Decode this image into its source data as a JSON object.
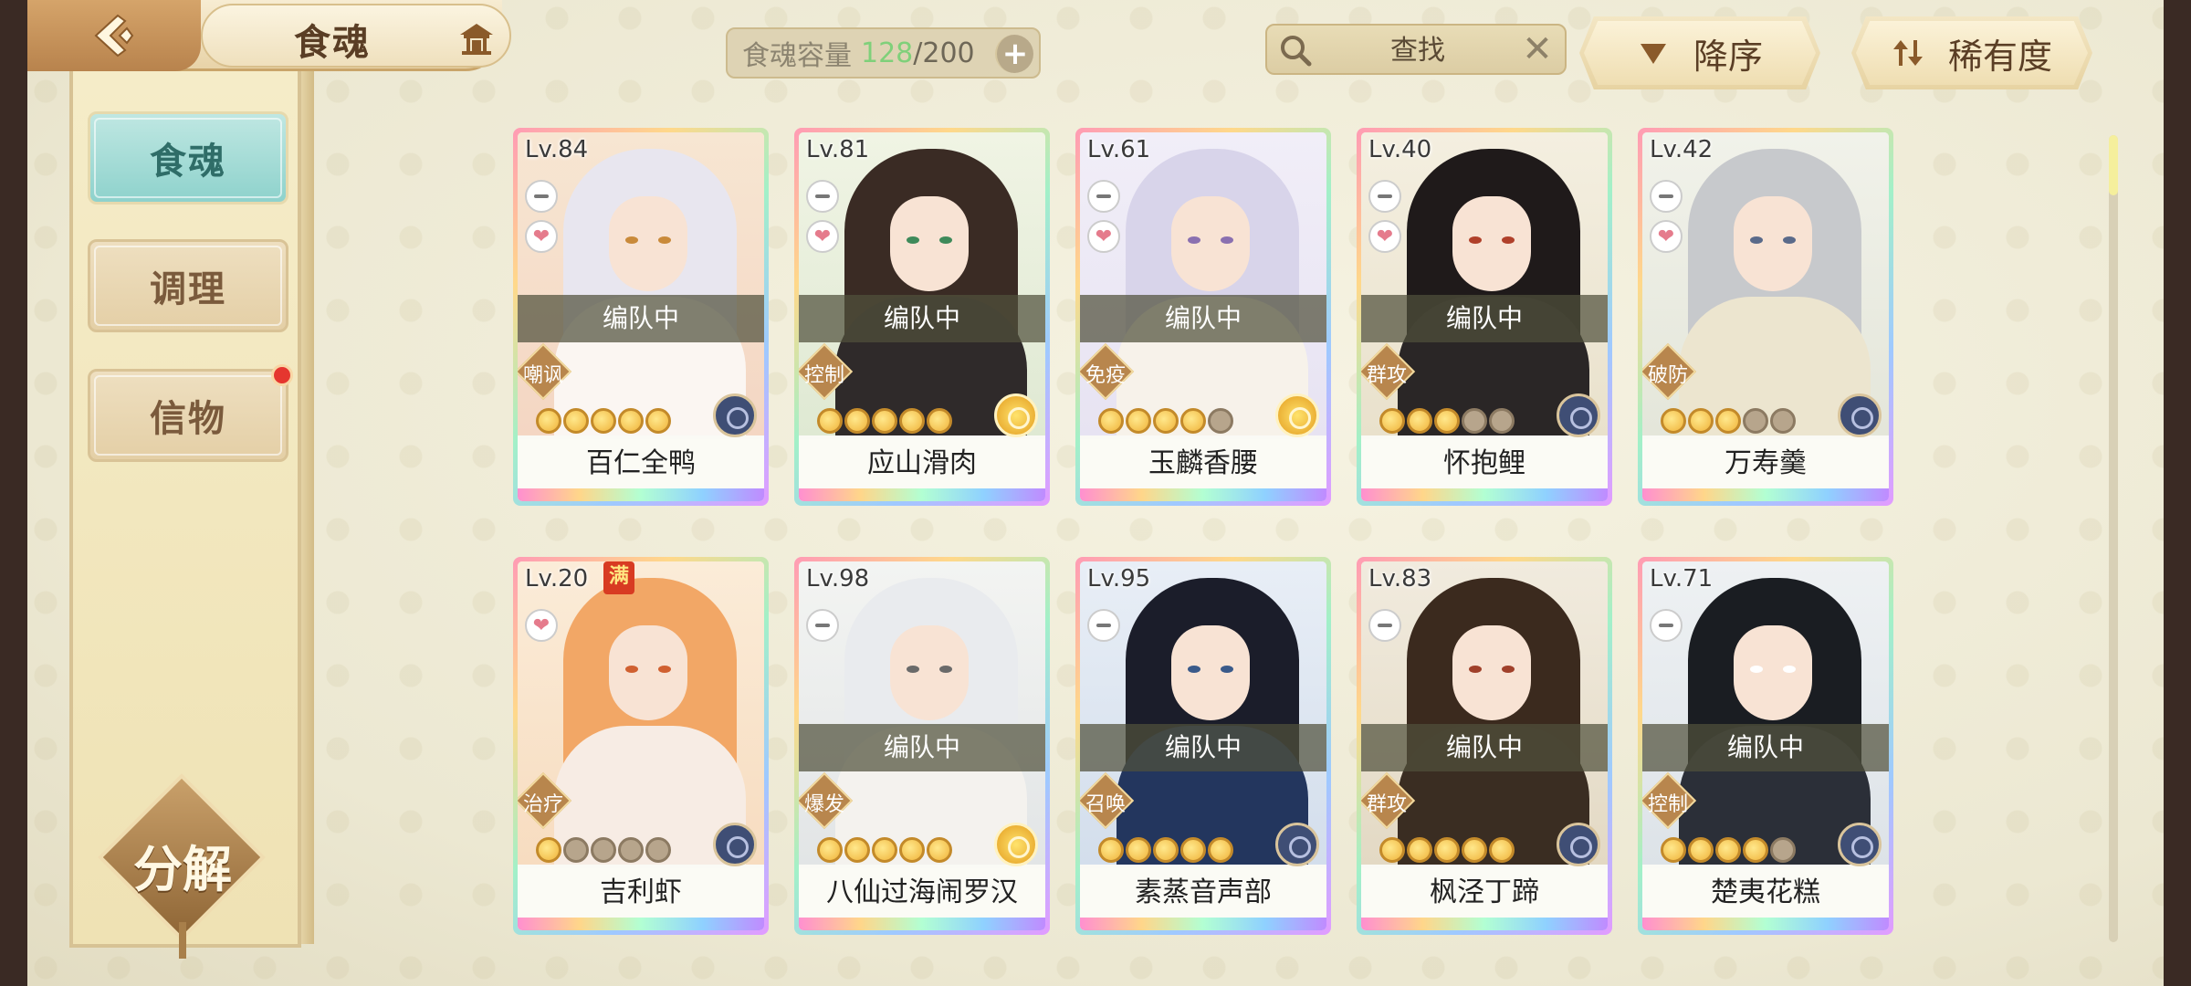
{
  "header": {
    "title": "食魂",
    "back_icon": "back-arrow-icon",
    "home_icon": "pavilion-icon"
  },
  "capacity": {
    "label": "食魂容量",
    "current": "128",
    "separator": "/",
    "max": "200",
    "plus": "+"
  },
  "search": {
    "placeholder": "查找",
    "clear": "✕"
  },
  "sort": {
    "order_label": "降序",
    "rarity_label": "稀有度"
  },
  "sidebar": {
    "tabs": [
      {
        "label": "食魂",
        "active": true
      },
      {
        "label": "调理",
        "active": false
      },
      {
        "label": "信物",
        "active": false,
        "badge": true
      }
    ],
    "decompose_label": "分解"
  },
  "team_label": "编队中",
  "full_badge": "满",
  "cards": [
    {
      "level": "Lv.84",
      "name": "百仁全鸭",
      "role": "嘲讽",
      "in_team": true,
      "stars_filled": 5,
      "element": "dark"
    },
    {
      "level": "Lv.81",
      "name": "应山滑肉",
      "role": "控制",
      "in_team": true,
      "stars_filled": 5,
      "element": "gold"
    },
    {
      "level": "Lv.61",
      "name": "玉麟香腰",
      "role": "免疫",
      "in_team": true,
      "stars_filled": 4,
      "element": "gold"
    },
    {
      "level": "Lv.40",
      "name": "怀抱鲤",
      "role": "群攻",
      "in_team": true,
      "stars_filled": 3,
      "element": "dark"
    },
    {
      "level": "Lv.42",
      "name": "万寿羹",
      "role": "破防",
      "in_team": false,
      "stars_filled": 3,
      "element": "dark"
    },
    {
      "level": "Lv.20",
      "name": "吉利虾",
      "role": "治疗",
      "in_team": false,
      "stars_filled": 1,
      "element": "dark",
      "full": true
    },
    {
      "level": "Lv.98",
      "name": "八仙过海闹罗汉",
      "role": "爆发",
      "in_team": true,
      "stars_filled": 5,
      "element": "gold"
    },
    {
      "level": "Lv.95",
      "name": "素蒸音声部",
      "role": "召唤",
      "in_team": true,
      "stars_filled": 5,
      "element": "dark"
    },
    {
      "level": "Lv.83",
      "name": "枫泾丁蹄",
      "role": "群攻",
      "in_team": true,
      "stars_filled": 5,
      "element": "dark"
    },
    {
      "level": "Lv.71",
      "name": "楚夷花糕",
      "role": "控制",
      "in_team": true,
      "stars_filled": 4,
      "element": "dark"
    }
  ],
  "colors": {
    "accent_teal": "#8ed2cc",
    "capacity_current": "#7fd07a",
    "badge_red": "#e5362f"
  }
}
